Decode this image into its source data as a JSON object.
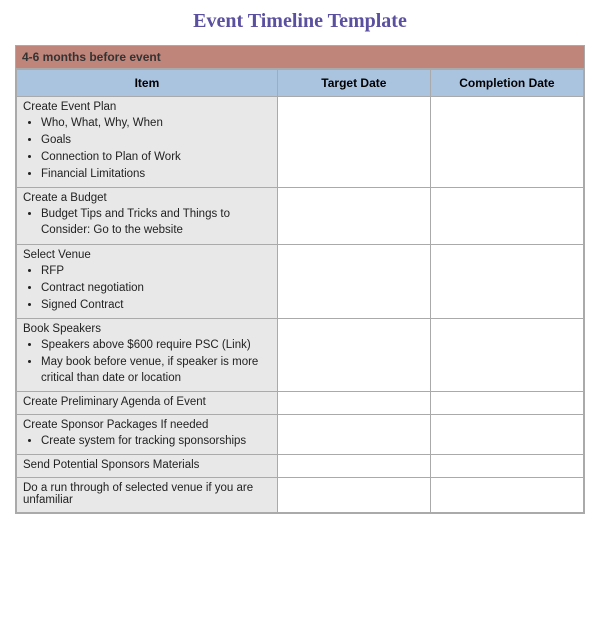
{
  "title": "Event Timeline Template",
  "section": {
    "label": "4-6 months before event"
  },
  "columns": {
    "item": "Item",
    "target_date": "Target Date",
    "completion_date": "Completion Date"
  },
  "rows": [
    {
      "title": "Create Event Plan",
      "bullets": [
        "Who, What, Why, When",
        "Goals",
        "Connection to Plan of Work",
        "Financial Limitations"
      ]
    },
    {
      "title": "Create a Budget",
      "bullets": [
        "Budget Tips and Tricks and Things to Consider: Go to the website"
      ]
    },
    {
      "title": "Select Venue",
      "bullets": [
        "RFP",
        "Contract negotiation",
        "Signed Contract"
      ]
    },
    {
      "title": "Book Speakers",
      "bullets": [
        "Speakers above $600 require PSC (Link)",
        "May book before venue, if speaker is more critical than date or location"
      ]
    },
    {
      "title": "Create Preliminary Agenda of Event",
      "bullets": []
    },
    {
      "title": "Create Sponsor Packages If needed",
      "bullets": [
        "Create system for tracking sponsorships"
      ]
    },
    {
      "title": "Send Potential Sponsors Materials",
      "bullets": []
    },
    {
      "title": "Do a run through of selected venue if you are unfamiliar",
      "bullets": []
    }
  ]
}
